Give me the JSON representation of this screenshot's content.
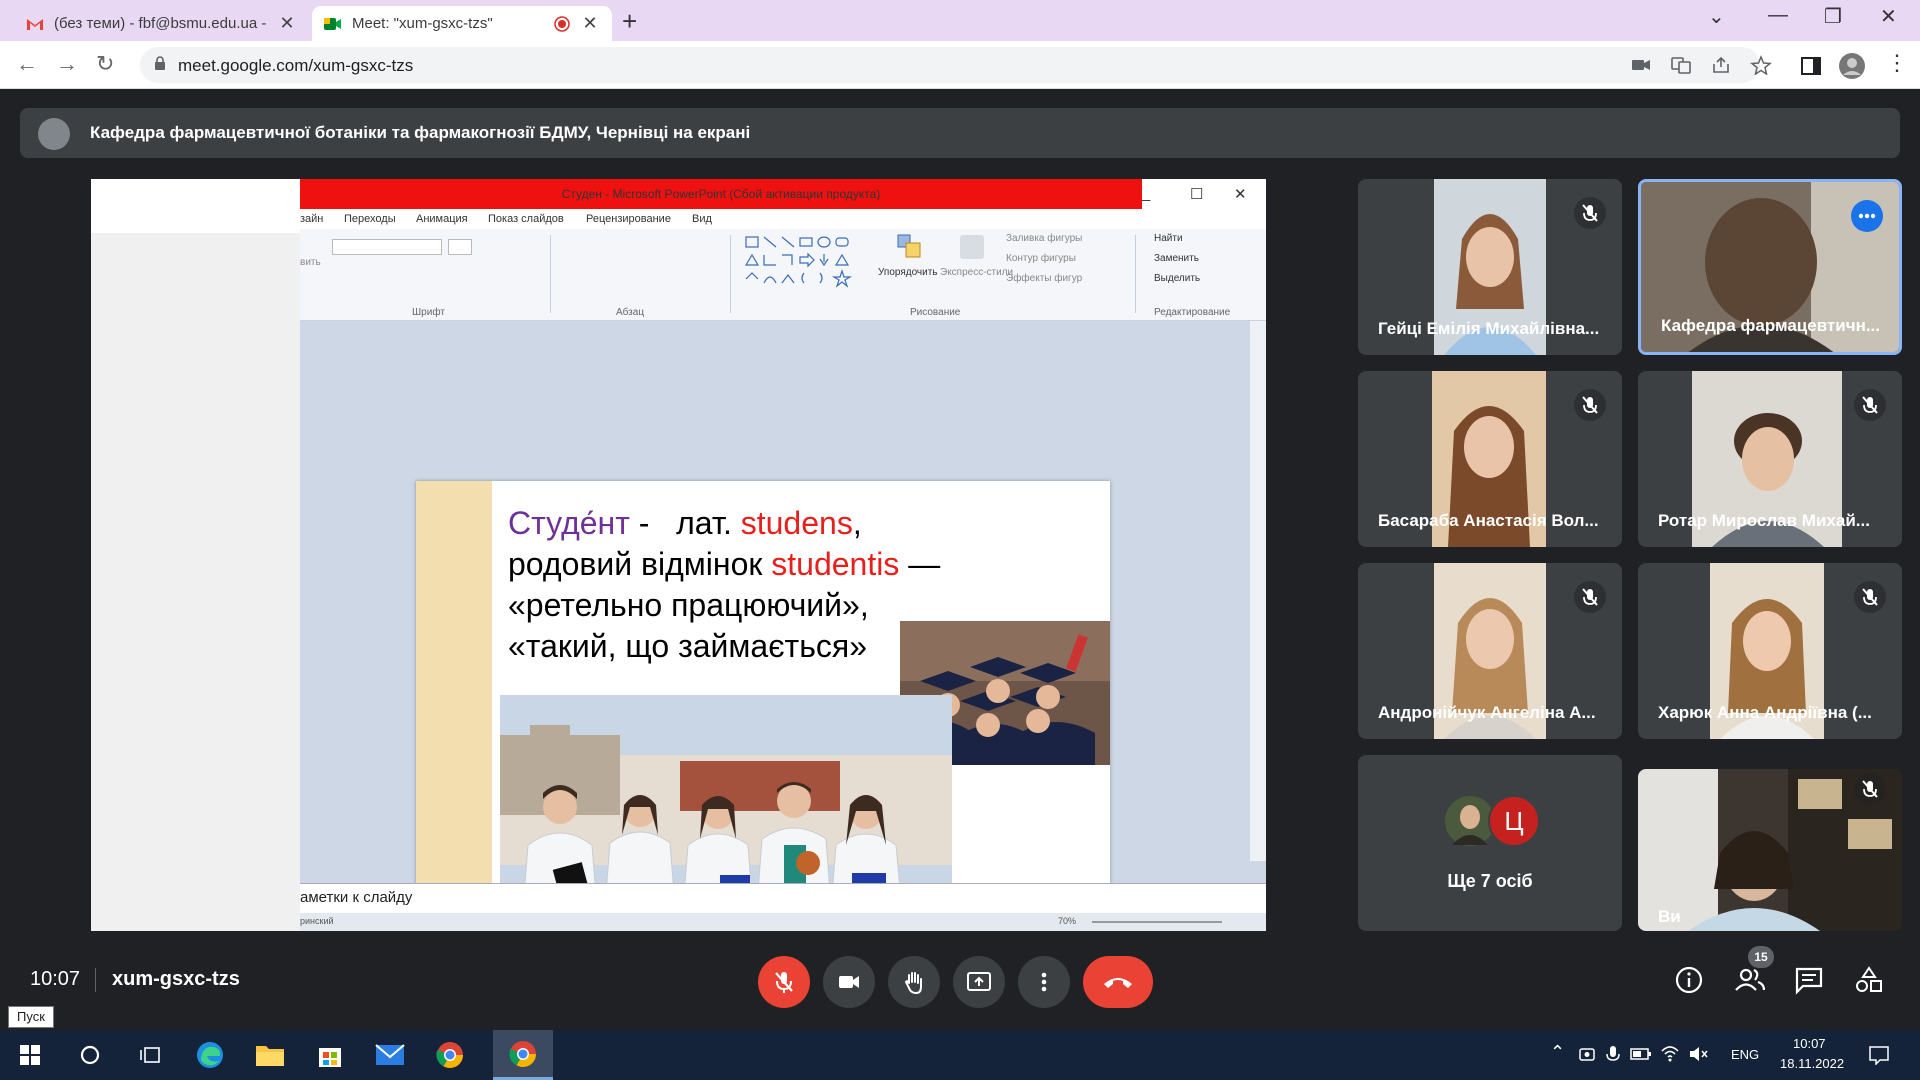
{
  "browser": {
    "tabs": [
      {
        "title": "(без теми) - fbf@bsmu.edu.ua - "
      },
      {
        "title": "Meet: \"xum-gsxc-tzs\""
      }
    ],
    "url": "meet.google.com/xum-gsxc-tzs"
  },
  "meet": {
    "banner": "Кафедра фармацевтичної ботаніки та фармакогнозії БДМУ, Чернівці на екрані",
    "time": "10:07",
    "code": "xum-gsxc-tzs",
    "participants_count": "15",
    "tiles": [
      {
        "name": "Гейці Емілія Михайлівна..."
      },
      {
        "name": "Кафедра фармацевтичн..."
      },
      {
        "name": "Басараба Анастасія Вол..."
      },
      {
        "name": "Ротар Мирослав Михай..."
      },
      {
        "name": "Андронійчук Ангеліна А..."
      },
      {
        "name": "Харюк Анна Андріївна (..."
      },
      {
        "name": "Ще 7 осіб"
      },
      {
        "name": "Ви"
      }
    ],
    "more_avatar_letter": "Ц",
    "colors": {
      "background": "#202124",
      "tile": "#3c4043",
      "end_call": "#ea4335",
      "active_border": "#8ab4f8"
    }
  },
  "ppt": {
    "title": "Студен - Microsoft PowerPoint (Сбой активации продукта)",
    "ribbon_tabs": [
      "зайн",
      "Переходы",
      "Анимация",
      "Показ слайдов",
      "Рецензирование",
      "Вид"
    ],
    "groups": [
      "Шрифт",
      "Абзац",
      "Рисование",
      "Редактирование"
    ],
    "ribbon_labels": {
      "paste": "вить",
      "arrange": "Упорядочить",
      "quick_styles": "Экспресс-стили",
      "fill": "Заливка фигуры",
      "outline": "Контур фигуры",
      "effects": "Эффекты фигур",
      "find": "Найти",
      "replace": "Заменить",
      "select": "Выделить"
    },
    "notes": "аметки к слайду",
    "status_lang": "ринский",
    "zoom": "70%",
    "slide": {
      "line1_word": "Студе́нт",
      "line1_dash": " -",
      "line1_lat": "лат.",
      "line1_latin": "studens",
      "line1_comma": ",",
      "line2_text": "родовий відмінок",
      "line2_latin": "studentis",
      "line2_dash": " —",
      "line3": "«ретельно працюючий»,",
      "line4": "«такий, що займається»"
    }
  },
  "taskbar": {
    "start_tooltip": "Пуск",
    "lang": "ENG",
    "clock_time": "10:07",
    "clock_date": "18.11.2022"
  }
}
